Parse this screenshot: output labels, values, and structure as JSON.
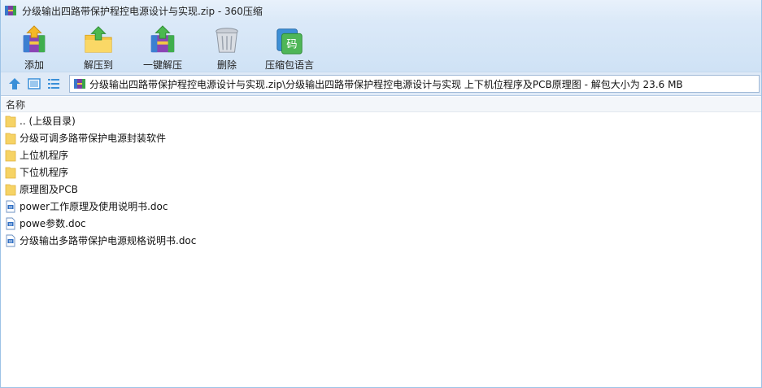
{
  "window": {
    "title": "分级输出四路带保护程控电源设计与实现.zip - 360压缩"
  },
  "toolbar": {
    "items": [
      {
        "label": "添加",
        "icon": "add-archive-icon"
      },
      {
        "label": "解压到",
        "icon": "extract-to-icon"
      },
      {
        "label": "一键解压",
        "icon": "one-click-extract-icon"
      },
      {
        "label": "删除",
        "icon": "trash-icon"
      },
      {
        "label": "压缩包语言",
        "icon": "archive-language-icon"
      }
    ]
  },
  "navbar": {
    "path": "分级输出四路带保护程控电源设计与实现.zip\\分级输出四路带保护程控电源设计与实现 上下机位程序及PCB原理图 - 解包大小为 23.6 MB"
  },
  "filelist": {
    "header": "名称",
    "items": [
      {
        "name": ".. (上级目录)",
        "type": "folder"
      },
      {
        "name": "分级可调多路带保护电源封装软件",
        "type": "folder"
      },
      {
        "name": "上位机程序",
        "type": "folder"
      },
      {
        "name": "下位机程序",
        "type": "folder"
      },
      {
        "name": "原理图及PCB",
        "type": "folder"
      },
      {
        "name": "power工作原理及使用说明书.doc",
        "type": "doc"
      },
      {
        "name": "powe参数.doc",
        "type": "doc"
      },
      {
        "name": "分级输出多路带保护电源规格说明书.doc",
        "type": "doc"
      }
    ]
  },
  "colors": {
    "accent": "#3a8fd8",
    "folder": "#f6d365",
    "titlebar_bg": "#dbe9f8"
  }
}
